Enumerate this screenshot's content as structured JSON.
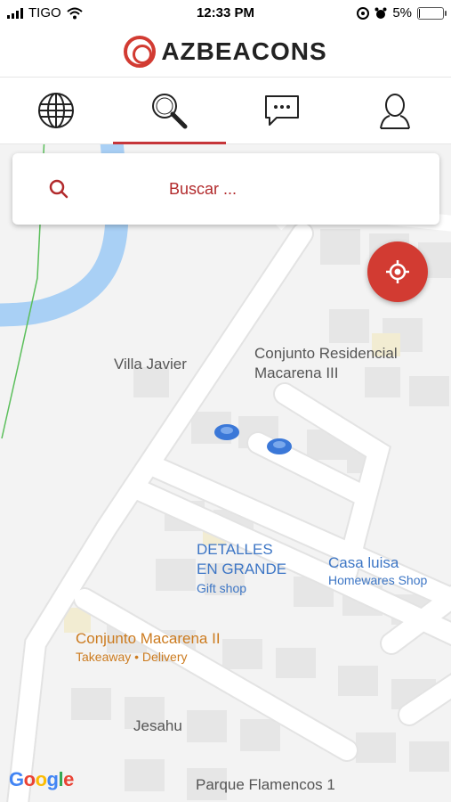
{
  "status_bar": {
    "carrier": "TIGO",
    "time": "12:33 PM",
    "battery": "5%",
    "battery_level": 0.05
  },
  "header": {
    "brand": "AZBEACONS"
  },
  "tabs": [
    {
      "name": "globe",
      "icon": "globe-icon"
    },
    {
      "name": "search",
      "icon": "search-icon",
      "active": true
    },
    {
      "name": "messages",
      "icon": "chat-bubble-icon"
    },
    {
      "name": "profile",
      "icon": "user-icon"
    }
  ],
  "search": {
    "placeholder": "Buscar ..."
  },
  "map": {
    "labels": {
      "villa_javier": "Villa Javier",
      "conjunto_residencial": "Conjunto Residencial",
      "macarena_iii": "Macarena III",
      "detalles_line1": "DETALLES",
      "detalles_line2": "EN GRANDE",
      "detalles_type": "Gift shop",
      "casa_luisa": "Casa luisa",
      "casa_luisa_type": "Homewares Shop",
      "conjunto_macarena": "Conjunto Macarena II",
      "conjunto_macarena_type": "Takeaway • Delivery",
      "jesahu": "Jesahu",
      "parque": "Parque Flamencos 1"
    },
    "attribution": "Google"
  },
  "colors": {
    "accent": "#d23b32",
    "water": "#a9d0f5",
    "place_blue": "#3d76c5",
    "place_orange": "#cc7b1f"
  }
}
